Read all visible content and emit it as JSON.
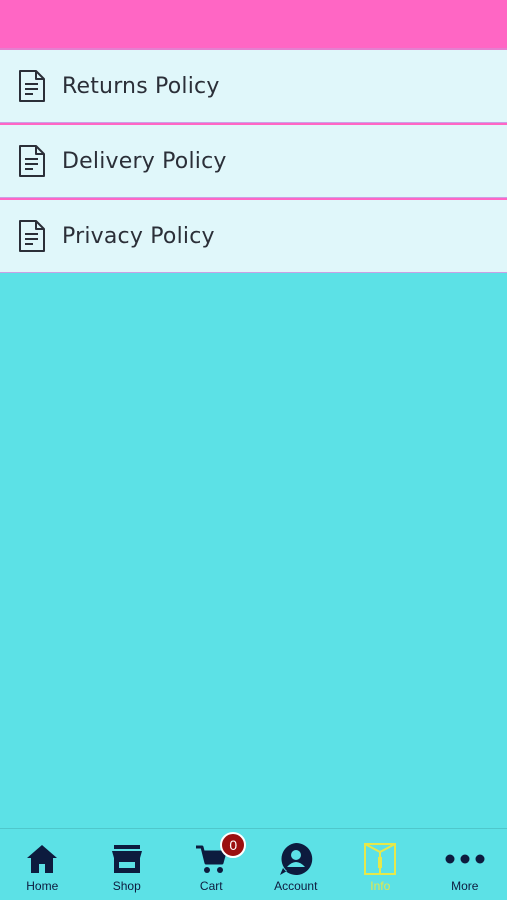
{
  "colors": {
    "header": "#ff66c4",
    "background": "#5ce1e6",
    "list_bg": "#e0f7fa",
    "nav_icon": "#0d1b3e",
    "nav_active": "#e6e84a",
    "badge": "#9b1010"
  },
  "policies": [
    {
      "label": "Returns Policy",
      "icon": "document-icon"
    },
    {
      "label": "Delivery Policy",
      "icon": "document-icon"
    },
    {
      "label": "Privacy Policy",
      "icon": "document-icon"
    }
  ],
  "tabbar": {
    "active": "Info",
    "tabs": [
      {
        "label": "Home",
        "icon": "home-icon"
      },
      {
        "label": "Shop",
        "icon": "store-icon"
      },
      {
        "label": "Cart",
        "icon": "cart-icon",
        "badge": "0"
      },
      {
        "label": "Account",
        "icon": "account-icon"
      },
      {
        "label": "Info",
        "icon": "info-icon"
      },
      {
        "label": "More",
        "icon": "more-icon"
      }
    ]
  }
}
